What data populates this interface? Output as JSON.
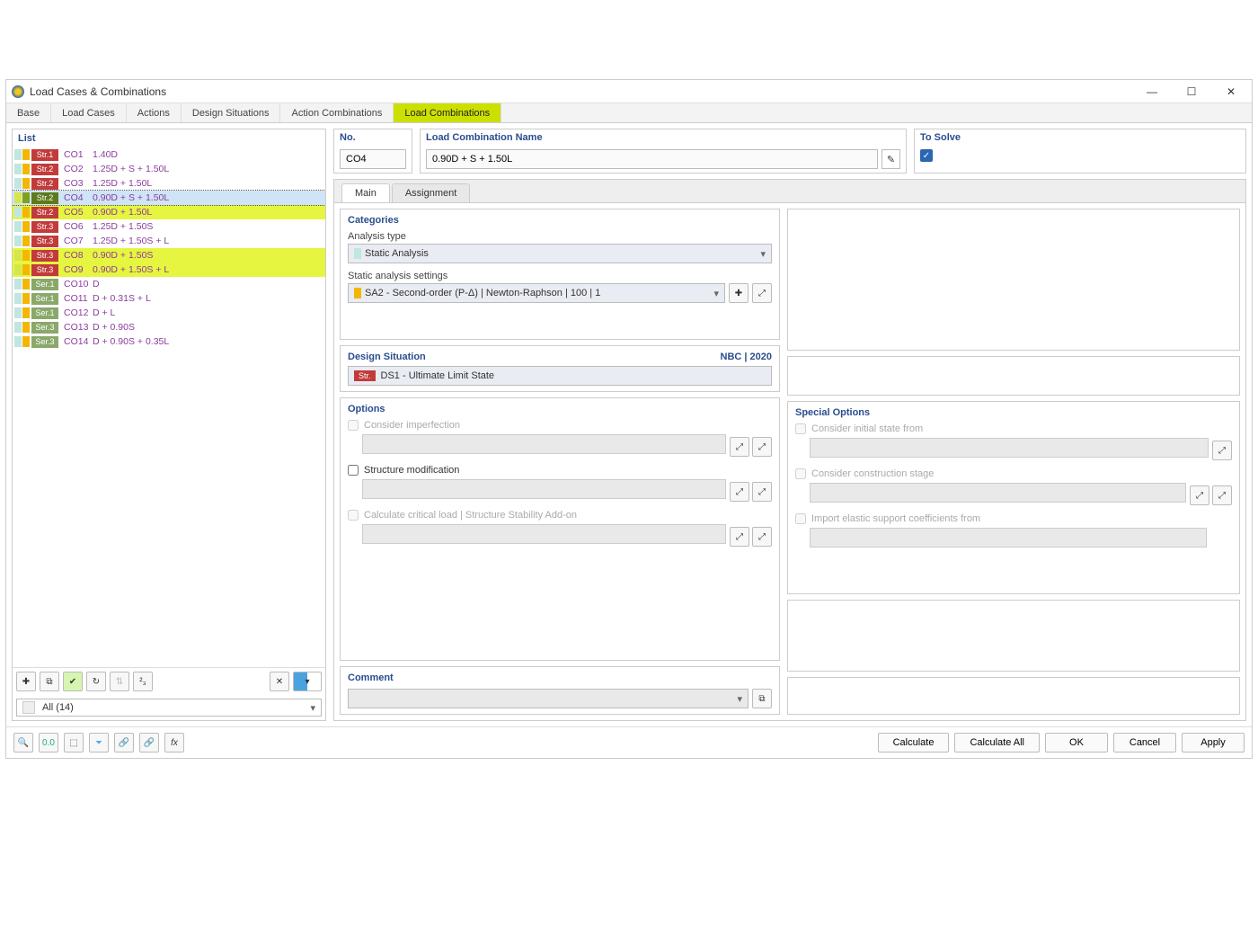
{
  "window": {
    "title": "Load Cases & Combinations"
  },
  "tabs": [
    "Base",
    "Load Cases",
    "Actions",
    "Design Situations",
    "Action Combinations",
    "Load Combinations"
  ],
  "activeTab": 5,
  "listTitle": "List",
  "rows": [
    {
      "s1": "#bfe7e0",
      "s2": "#f2b705",
      "badge": "Str.1",
      "bgc": "#c23b3b",
      "no": "CO1",
      "name": "1.40D",
      "sel": false,
      "hl": false
    },
    {
      "s1": "#bfe7e0",
      "s2": "#f2b705",
      "badge": "Str.2",
      "bgc": "#c23b3b",
      "no": "CO2",
      "name": "1.25D + S + 1.50L",
      "sel": false,
      "hl": false
    },
    {
      "s1": "#bfe7e0",
      "s2": "#f2b705",
      "badge": "Str.2",
      "bgc": "#c23b3b",
      "no": "CO3",
      "name": "1.25D + 1.50L",
      "sel": false,
      "hl": false
    },
    {
      "s1": "#d6e64a",
      "s2": "#7fa01e",
      "badge": "Str.2",
      "bgc": "#5e7a1e",
      "no": "CO4",
      "name": "0.90D + S + 1.50L",
      "sel": true,
      "hl": true
    },
    {
      "s1": "#bfe7e0",
      "s2": "#f2b705",
      "badge": "Str.2",
      "bgc": "#c23b3b",
      "no": "CO5",
      "name": "0.90D + 1.50L",
      "sel": false,
      "hl": true
    },
    {
      "s1": "#bfe7e0",
      "s2": "#f2b705",
      "badge": "Str.3",
      "bgc": "#c23b3b",
      "no": "CO6",
      "name": "1.25D + 1.50S",
      "sel": false,
      "hl": false
    },
    {
      "s1": "#bfe7e0",
      "s2": "#f2b705",
      "badge": "Str.3",
      "bgc": "#c23b3b",
      "no": "CO7",
      "name": "1.25D + 1.50S + L",
      "sel": false,
      "hl": false
    },
    {
      "s1": "#d6e64a",
      "s2": "#f2b705",
      "badge": "Str.3",
      "bgc": "#c23b3b",
      "no": "CO8",
      "name": "0.90D + 1.50S",
      "sel": false,
      "hl": true
    },
    {
      "s1": "#d6e64a",
      "s2": "#f2b705",
      "badge": "Str.3",
      "bgc": "#c23b3b",
      "no": "CO9",
      "name": "0.90D + 1.50S + L",
      "sel": false,
      "hl": true
    },
    {
      "s1": "#bfe7e0",
      "s2": "#f2b705",
      "badge": "Ser.1",
      "bgc": "#8aa86a",
      "no": "CO10",
      "name": "D",
      "sel": false,
      "hl": false
    },
    {
      "s1": "#bfe7e0",
      "s2": "#f2b705",
      "badge": "Ser.1",
      "bgc": "#8aa86a",
      "no": "CO11",
      "name": "D + 0.31S + L",
      "sel": false,
      "hl": false
    },
    {
      "s1": "#bfe7e0",
      "s2": "#f2b705",
      "badge": "Ser.1",
      "bgc": "#8aa86a",
      "no": "CO12",
      "name": "D + L",
      "sel": false,
      "hl": false
    },
    {
      "s1": "#bfe7e0",
      "s2": "#f2b705",
      "badge": "Ser.3",
      "bgc": "#8aa86a",
      "no": "CO13",
      "name": "D + 0.90S",
      "sel": false,
      "hl": false
    },
    {
      "s1": "#bfe7e0",
      "s2": "#f2b705",
      "badge": "Ser.3",
      "bgc": "#8aa86a",
      "no": "CO14",
      "name": "D + 0.90S + 0.35L",
      "sel": false,
      "hl": false
    }
  ],
  "filterLabel": "All (14)",
  "header": {
    "noTitle": "No.",
    "nameTitle": "Load Combination Name",
    "solveTitle": "To Solve",
    "noValue": "CO4",
    "nameValue": "0.90D + S + 1.50L"
  },
  "innerTabs": [
    "Main",
    "Assignment"
  ],
  "categories": {
    "title": "Categories",
    "analysisLabel": "Analysis type",
    "analysisValue": "Static Analysis",
    "settingsLabel": "Static analysis settings",
    "settingsValue": "SA2 - Second-order (P-Δ) | Newton-Raphson | 100 | 1",
    "settingsColor": "#f2b705"
  },
  "designSituation": {
    "title": "Design Situation",
    "code": "NBC | 2020",
    "badge": "Str.",
    "value": "DS1 - Ultimate Limit State"
  },
  "options": {
    "title": "Options",
    "o1": "Consider imperfection",
    "o2": "Structure modification",
    "o3": "Calculate critical load | Structure Stability Add-on"
  },
  "special": {
    "title": "Special Options",
    "s1": "Consider initial state from",
    "s2": "Consider construction stage",
    "s3": "Import elastic support coefficients from"
  },
  "commentTitle": "Comment",
  "buttons": {
    "calc": "Calculate",
    "calcAll": "Calculate All",
    "ok": "OK",
    "cancel": "Cancel",
    "apply": "Apply"
  }
}
